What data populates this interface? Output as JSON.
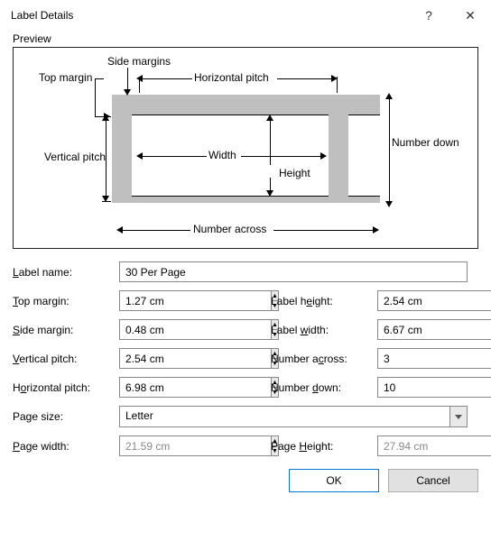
{
  "window": {
    "title": "Label Details",
    "help_glyph": "?",
    "close_glyph": "✕"
  },
  "preview": {
    "legend": "Preview",
    "side_margins": "Side margins",
    "top_margin": "Top margin",
    "horizontal_pitch": "Horizontal pitch",
    "vertical_pitch": "Vertical pitch",
    "width": "Width",
    "height": "Height",
    "number_down": "Number down",
    "number_across": "Number across"
  },
  "form": {
    "label_name": {
      "label": "Label name:",
      "value": "30 Per Page"
    },
    "top_margin": {
      "label": "Top margin:",
      "value": "1.27 cm"
    },
    "side_margin": {
      "label": "Side margin:",
      "value": "0.48 cm"
    },
    "vertical_pitch": {
      "label": "Vertical pitch:",
      "value": "2.54 cm"
    },
    "horizontal_pitch": {
      "label": "Horizontal pitch:",
      "value": "6.98 cm"
    },
    "label_height": {
      "label": "Label height:",
      "value": "2.54 cm"
    },
    "label_width": {
      "label": "Label width:",
      "value": "6.67 cm"
    },
    "number_across": {
      "label": "Number across:",
      "value": "3"
    },
    "number_down": {
      "label": "Number down:",
      "value": "10"
    },
    "page_size": {
      "label": "Page size:",
      "value": "Letter"
    },
    "page_width": {
      "label": "Page width:",
      "value": "21.59 cm"
    },
    "page_height": {
      "label": "Page Height:",
      "value": "27.94 cm"
    }
  },
  "buttons": {
    "ok": "OK",
    "cancel": "Cancel"
  }
}
